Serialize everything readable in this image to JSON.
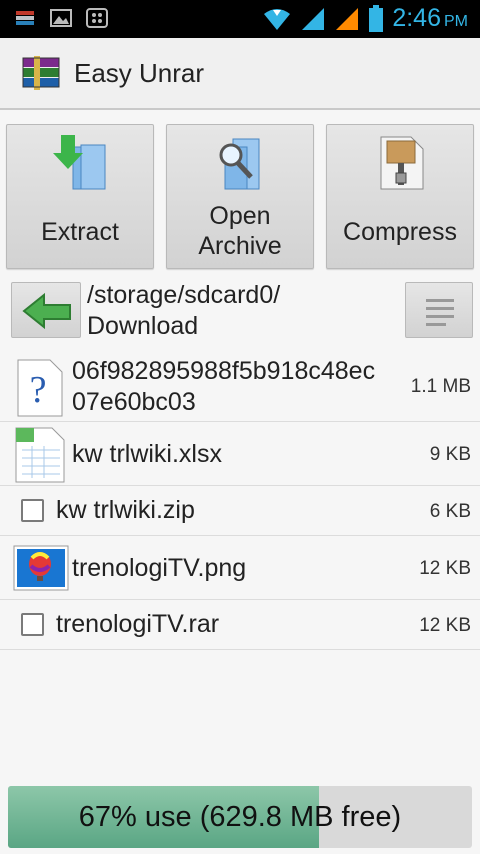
{
  "status_bar": {
    "time": "2:46",
    "ampm": "PM",
    "accent_color": "#33b5e5",
    "left_icons": [
      "stack-notification-icon",
      "image-notification-icon",
      "bbm-notification-icon"
    ],
    "right_icons": [
      "wifi-icon",
      "signal-icon",
      "signal-2-icon",
      "battery-icon"
    ]
  },
  "app": {
    "title": "Easy Unrar",
    "icon": "winrar-books-icon"
  },
  "actions": {
    "extract_label": "Extract",
    "open_label_line1": "Open",
    "open_label_line2": "Archive",
    "compress_label": "Compress"
  },
  "path": {
    "line1": "/storage/sdcard0/",
    "line2": "Download"
  },
  "files": [
    {
      "name_line1": "06f982895988f5b918c48ec",
      "name_line2": "07e60bc03",
      "size": "1.1 MB",
      "icon": "unknown-file-icon"
    },
    {
      "name": "kw trlwiki.xlsx",
      "size": "9 KB",
      "icon": "spreadsheet-file-icon"
    },
    {
      "name": "kw trlwiki.zip",
      "size": "6 KB",
      "icon": "checkbox"
    },
    {
      "name": "trenologiTV.png",
      "size": "12 KB",
      "icon": "image-file-icon"
    },
    {
      "name": "trenologiTV.rar",
      "size": "12 KB",
      "icon": "checkbox"
    }
  ],
  "storage": {
    "label": "67% use (629.8 MB free)",
    "used_fraction": 0.67,
    "fill_color": "#6fb592"
  }
}
